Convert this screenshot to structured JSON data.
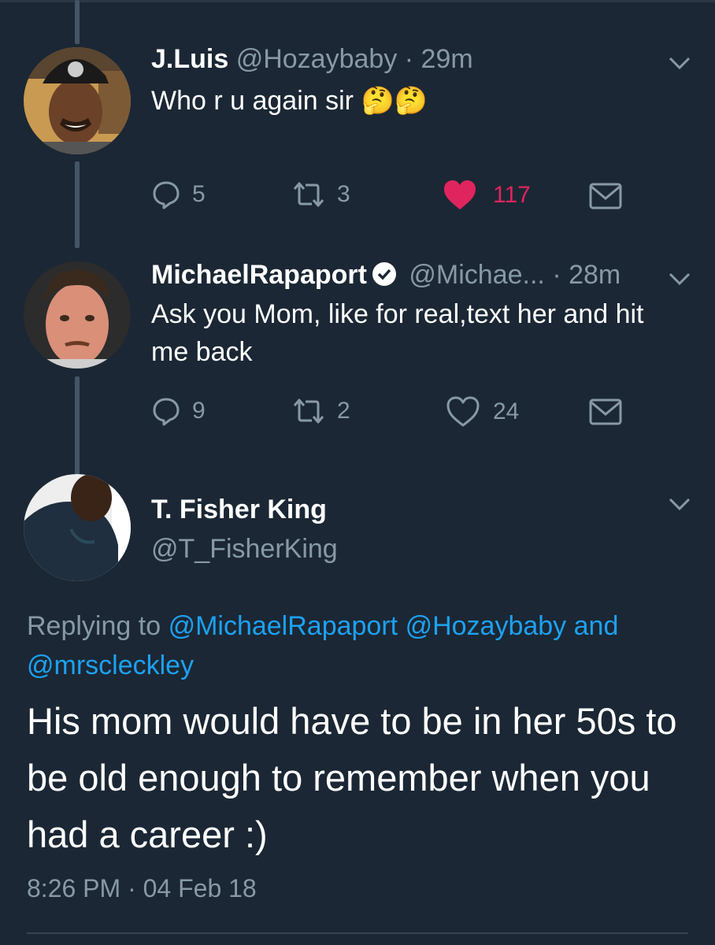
{
  "tweets": [
    {
      "name": "J.Luis",
      "handle": "@Hozaybaby",
      "time": "· 29m",
      "text": "Who r u again sir 🤔🤔",
      "replies": "5",
      "retweets": "3",
      "likes": "117",
      "liked": true
    },
    {
      "name": "MichaelRapaport",
      "handle": "@Michae...",
      "time": "· 28m",
      "text": "Ask you Mom, like for real,text her and hit me back",
      "replies": "9",
      "retweets": "2",
      "likes": "24",
      "liked": false,
      "verified": true
    }
  ],
  "main_tweet": {
    "name": "T. Fisher King",
    "handle": "@T_FisherKing",
    "replying_prefix": "Replying to",
    "reply_mentions": [
      "@MichaelRapaport",
      "@Hozaybaby"
    ],
    "reply_and": "and",
    "reply_last": "@mrscleckley",
    "text": "His mom would have to be in her 50s to be old enough to remember when you had a career :)",
    "timestamp": "8:26 PM · 04 Feb 18"
  },
  "colors": {
    "background": "#1b2734",
    "secondary_text": "#8899a6",
    "link": "#1da1f2",
    "like": "#e0245e",
    "thread_line": "#445566"
  },
  "icons": [
    "reply-icon",
    "retweet-icon",
    "heart-icon",
    "direct-message-icon",
    "chevron-down-icon",
    "verified-badge-icon"
  ]
}
